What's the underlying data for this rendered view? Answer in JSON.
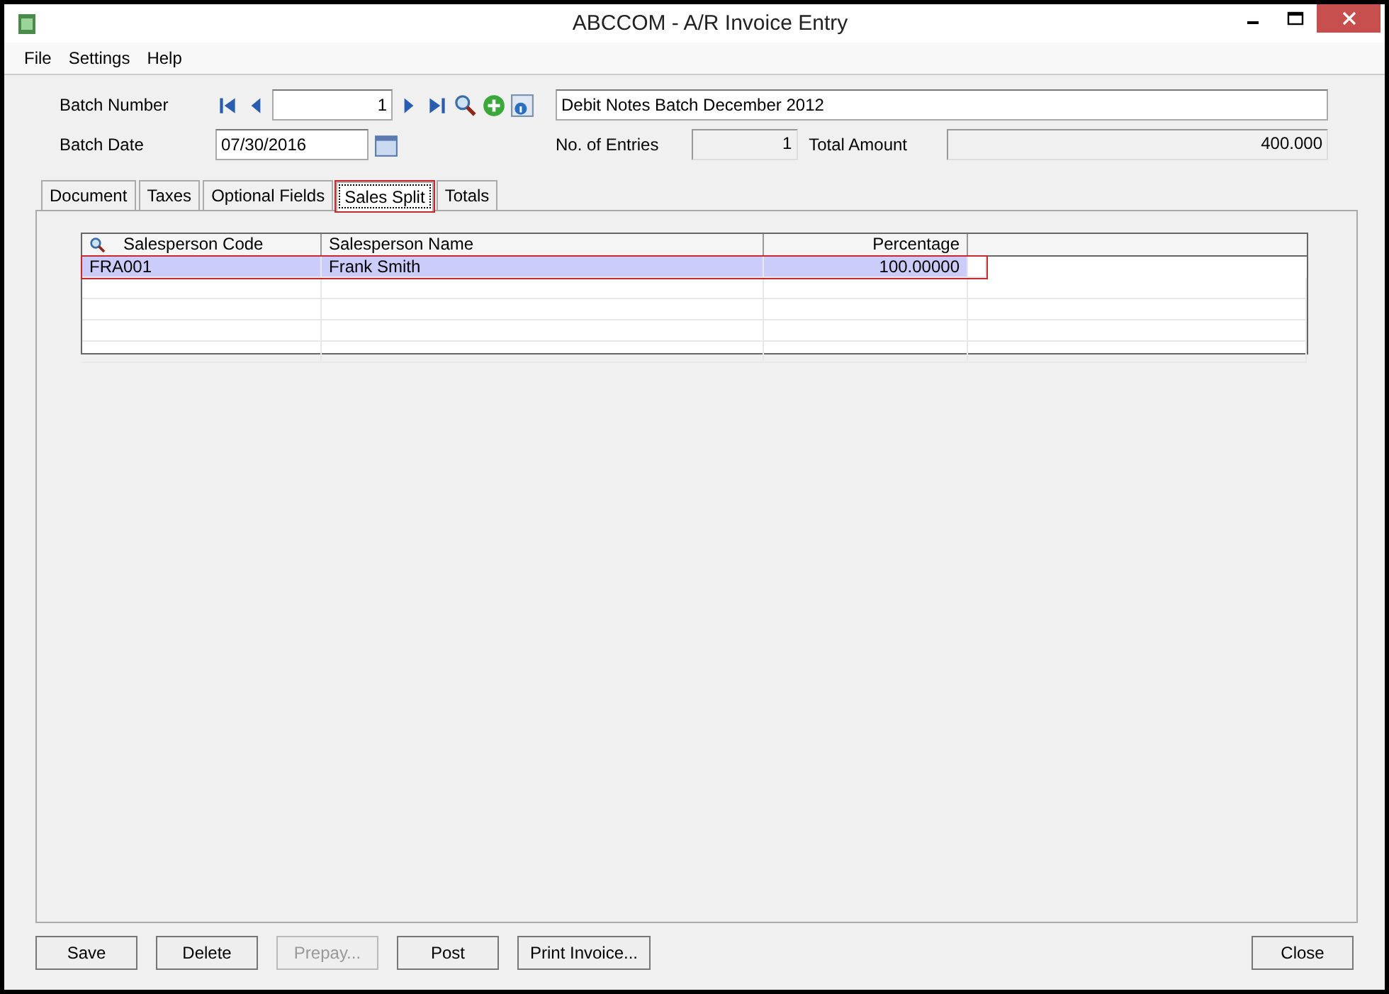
{
  "window": {
    "title": "ABCCOM - A/R Invoice Entry"
  },
  "menu": [
    "File",
    "Settings",
    "Help"
  ],
  "header": {
    "batch_number_label": "Batch Number",
    "batch_number": "1",
    "batch_description": "Debit Notes Batch December 2012",
    "batch_date_label": "Batch Date",
    "batch_date": "07/30/2016",
    "entries_label": "No. of Entries",
    "entries": "1",
    "total_label": "Total Amount",
    "total": "400.000"
  },
  "tabs": [
    {
      "label": "Document",
      "selected": false,
      "highlighted": false
    },
    {
      "label": "Taxes",
      "selected": false,
      "highlighted": false
    },
    {
      "label": "Optional Fields",
      "selected": false,
      "highlighted": false
    },
    {
      "label": "Sales Split",
      "selected": true,
      "highlighted": true
    },
    {
      "label": "Totals",
      "selected": false,
      "highlighted": false
    }
  ],
  "table": {
    "columns": [
      "Salesperson Code",
      "Salesperson Name",
      "Percentage"
    ],
    "rows": [
      {
        "cells": [
          "FRA001",
          "Frank Smith",
          "100.00000"
        ],
        "selected": true,
        "highlighted": true
      }
    ]
  },
  "buttons": [
    {
      "label": "Save",
      "disabled": false
    },
    {
      "label": "Delete",
      "disabled": false
    },
    {
      "label": "Prepay...",
      "disabled": true
    },
    {
      "label": "Post",
      "disabled": false
    },
    {
      "label": "Print Invoice...",
      "disabled": false
    }
  ],
  "close_button": {
    "label": "Close",
    "disabled": false
  }
}
